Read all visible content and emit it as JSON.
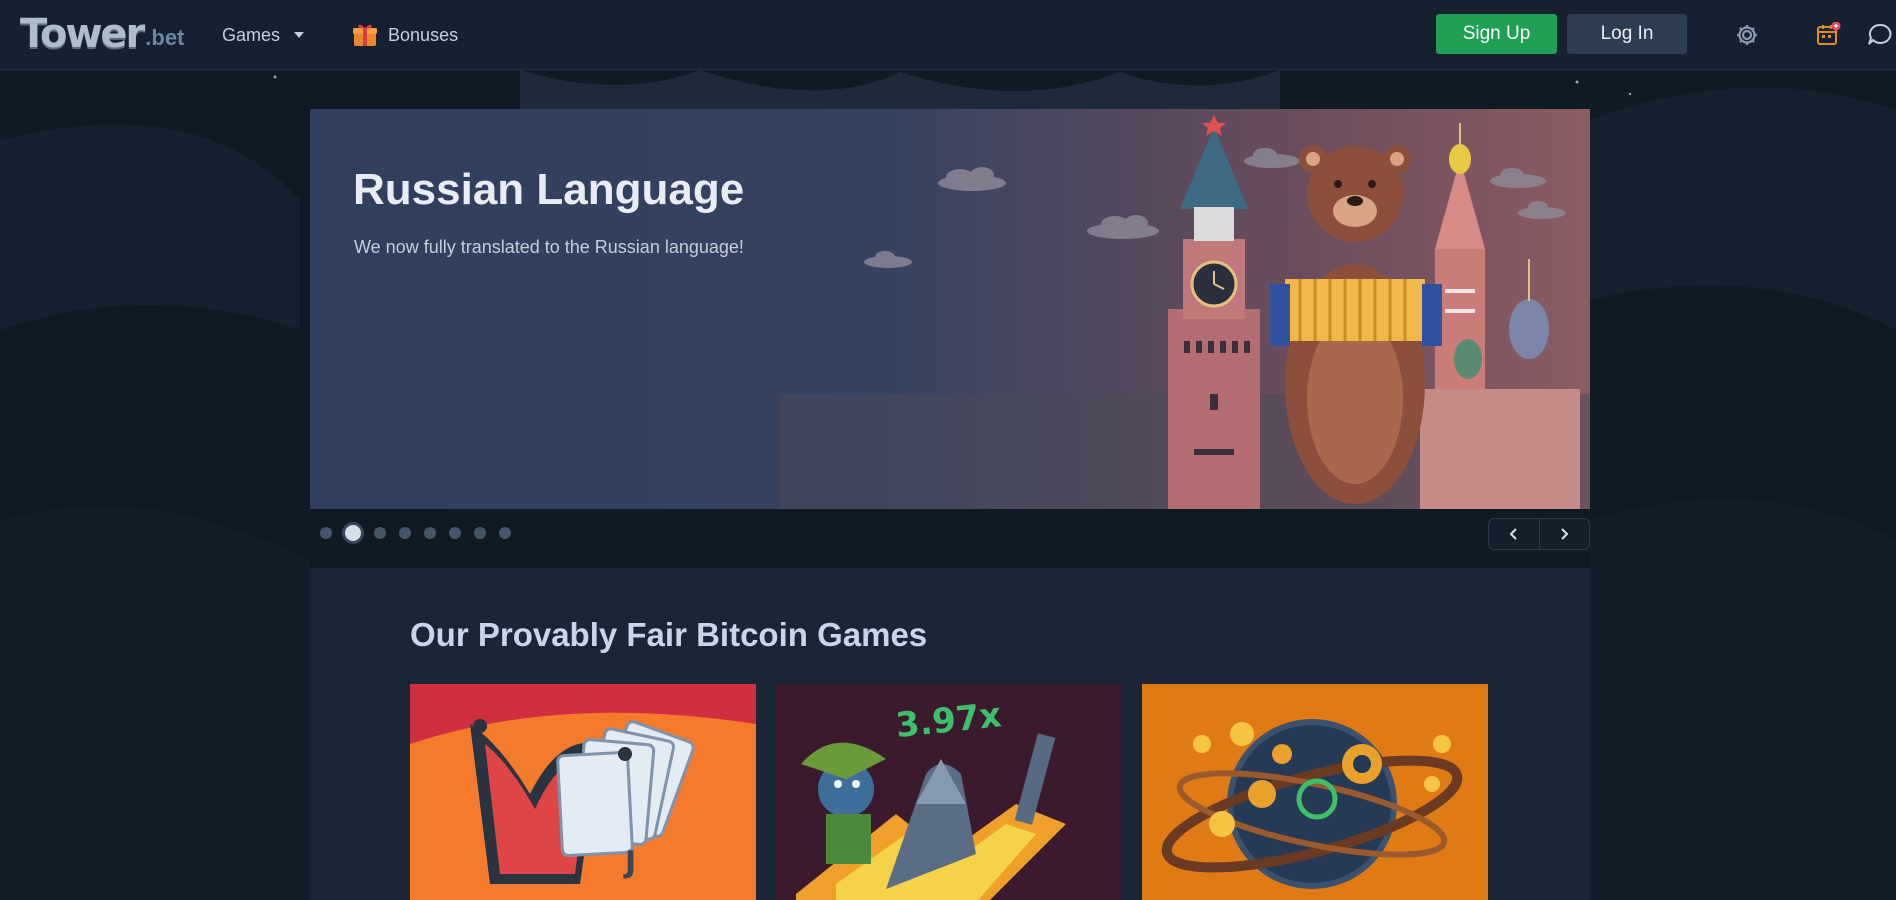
{
  "header": {
    "logo_main": "Tower",
    "logo_suffix": ".bet",
    "nav": [
      {
        "label": "Games",
        "icon": "chevron-down-icon"
      },
      {
        "label": "Bonuses",
        "icon": "gift-icon"
      }
    ],
    "signup_label": "Sign Up",
    "login_label": "Log In",
    "icons": [
      "gear-icon",
      "calendar-icon",
      "chat-icon"
    ]
  },
  "banner": {
    "title": "Russian Language",
    "subtitle": "We now fully translated to the Russian language!",
    "slides_count": 8,
    "active_slide": 2
  },
  "games": {
    "title": "Our Provably Fair Bitcoin Games",
    "cards": [
      {
        "name": "Blackjack game",
        "accent": "#f26b2b"
      },
      {
        "name": "Crash game",
        "multiplier": "3.97x",
        "accent": "#3b1a2d"
      },
      {
        "name": "Planet game",
        "accent": "#e07a14"
      }
    ]
  },
  "colors": {
    "signup": "#1fa055",
    "login": "#2e3e51",
    "header_bg": "#152131",
    "page_bg": "#101a25"
  }
}
